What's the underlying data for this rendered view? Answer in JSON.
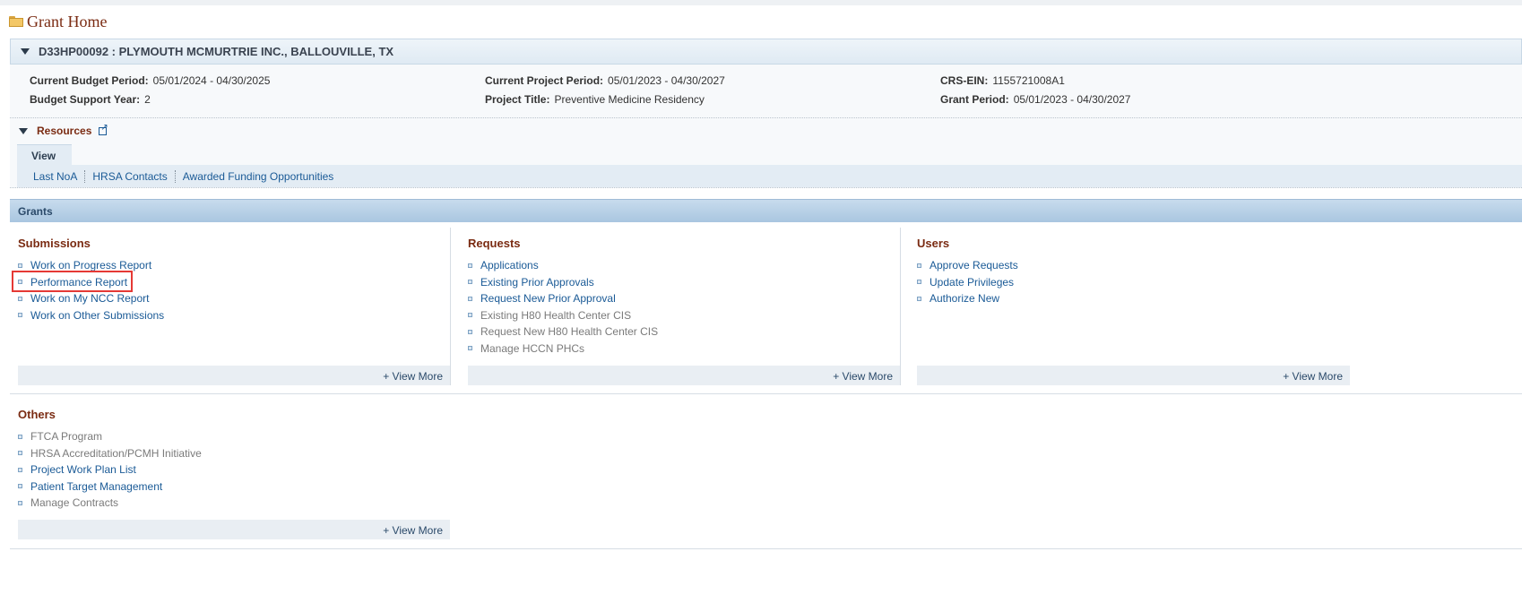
{
  "page": {
    "title": "Grant Home",
    "icon": "folder-icon"
  },
  "grant": {
    "header": "D33HP00092 : PLYMOUTH MCMURTRIE INC., BALLOUVILLE, TX",
    "fields": {
      "current_budget_period": {
        "label": "Current Budget Period:",
        "value": "05/01/2024 - 04/30/2025"
      },
      "budget_support_year": {
        "label": "Budget Support Year:",
        "value": "2"
      },
      "current_project_period": {
        "label": "Current Project Period:",
        "value": "05/01/2023 - 04/30/2027"
      },
      "project_title": {
        "label": "Project Title:",
        "value": "Preventive Medicine Residency"
      },
      "crs_ein": {
        "label": "CRS-EIN:",
        "value": "1155721008A1"
      },
      "grant_period": {
        "label": "Grant Period:",
        "value": "05/01/2023 - 04/30/2027"
      }
    }
  },
  "resources": {
    "title": "Resources",
    "tab": "View",
    "links": [
      "Last NoA",
      "HRSA Contacts",
      "Awarded Funding Opportunities"
    ]
  },
  "grants_bar": {
    "title": "Grants"
  },
  "submissions": {
    "title": "Submissions",
    "items": [
      "Work on Progress Report",
      "Performance Report",
      "Work on My NCC Report",
      "Work on Other Submissions"
    ],
    "view_more": "+ View More"
  },
  "requests": {
    "title": "Requests",
    "items": [
      "Applications",
      "Existing Prior Approvals",
      "Request New Prior Approval",
      "Existing H80 Health Center CIS",
      "Request New H80 Health Center CIS",
      "Manage HCCN PHCs"
    ],
    "view_more": "+ View More"
  },
  "users": {
    "title": "Users",
    "items": [
      "Approve Requests",
      "Update Privileges",
      "Authorize New"
    ],
    "view_more": "+ View More"
  },
  "others": {
    "title": "Others",
    "items": [
      "FTCA Program",
      "HRSA Accreditation/PCMH Initiative",
      "Project Work Plan List",
      "Patient Target Management",
      "Manage Contracts"
    ],
    "view_more": "+ View More"
  },
  "colors": {
    "link": "#1a5a96",
    "section_title": "#7a2b12",
    "highlight": "#e53935"
  }
}
